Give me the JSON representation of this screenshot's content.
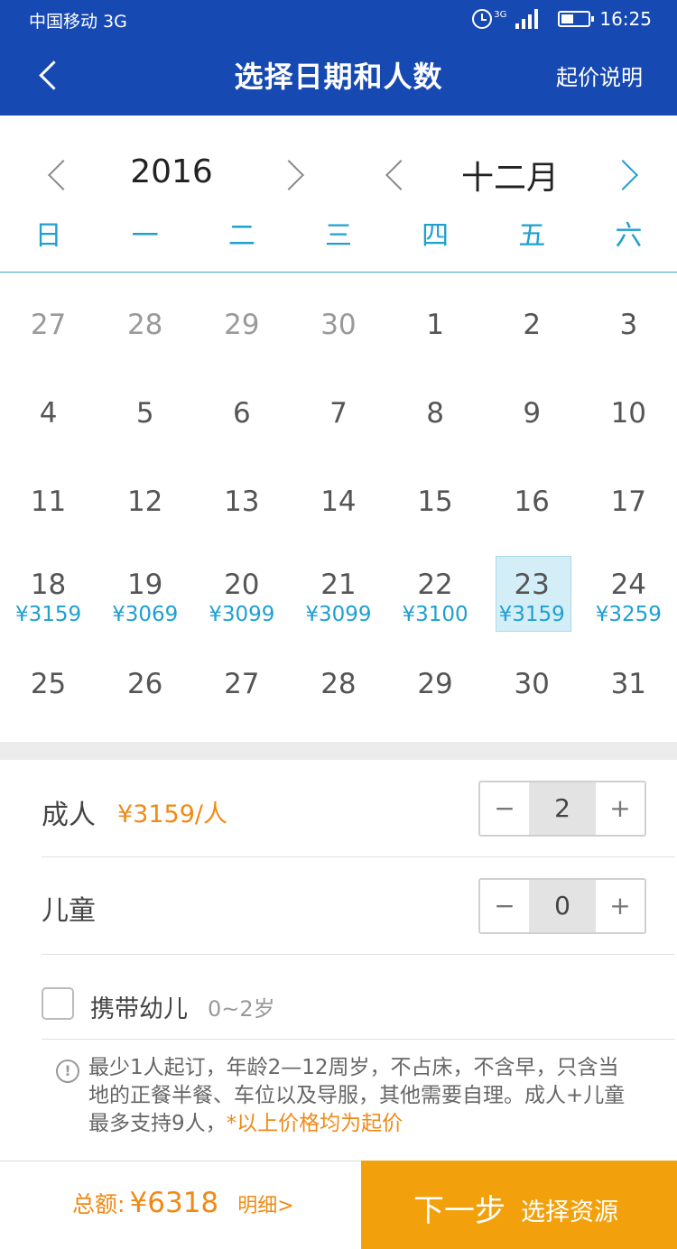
{
  "status_bar": {
    "carrier": "中国移动 3G",
    "network": "3G",
    "time": "16:25",
    "battery_level": 0.45
  },
  "header": {
    "title": "选择日期和人数",
    "right_link": "起价说明"
  },
  "calendar": {
    "year": "2016",
    "month": "十二月",
    "weekdays": [
      "日",
      "一",
      "二",
      "三",
      "四",
      "五",
      "六"
    ],
    "weeks": [
      [
        {
          "day": "27",
          "other": true
        },
        {
          "day": "28",
          "other": true
        },
        {
          "day": "29",
          "other": true
        },
        {
          "day": "30",
          "other": true
        },
        {
          "day": "1"
        },
        {
          "day": "2"
        },
        {
          "day": "3"
        }
      ],
      [
        {
          "day": "4"
        },
        {
          "day": "5"
        },
        {
          "day": "6"
        },
        {
          "day": "7"
        },
        {
          "day": "8"
        },
        {
          "day": "9"
        },
        {
          "day": "10"
        }
      ],
      [
        {
          "day": "11"
        },
        {
          "day": "12"
        },
        {
          "day": "13"
        },
        {
          "day": "14"
        },
        {
          "day": "15"
        },
        {
          "day": "16"
        },
        {
          "day": "17"
        }
      ],
      [
        {
          "day": "18",
          "price": "¥3159"
        },
        {
          "day": "19",
          "price": "¥3069"
        },
        {
          "day": "20",
          "price": "¥3099"
        },
        {
          "day": "21",
          "price": "¥3099"
        },
        {
          "day": "22",
          "price": "¥3100"
        },
        {
          "day": "23",
          "price": "¥3159",
          "selected": true
        },
        {
          "day": "24",
          "price": "¥3259"
        }
      ],
      [
        {
          "day": "25"
        },
        {
          "day": "26"
        },
        {
          "day": "27"
        },
        {
          "day": "28"
        },
        {
          "day": "29"
        },
        {
          "day": "30"
        },
        {
          "day": "31"
        }
      ]
    ]
  },
  "passengers": {
    "adult": {
      "label": "成人",
      "price": "¥3159/人",
      "minus": "−",
      "value": "2",
      "plus": "+"
    },
    "child": {
      "label": "儿童",
      "minus": "−",
      "value": "0",
      "plus": "+"
    },
    "infant": {
      "label": "携带幼儿",
      "age": "0~2岁",
      "checked": false
    }
  },
  "notice": {
    "text": "最少1人起订，年龄2—12周岁，不占床，不含早，只含当地的正餐半餐、车位以及导服，其他需要自理。成人+儿童最多支持9人，",
    "highlight": "*以上价格均为起价"
  },
  "footer": {
    "total_label": "总额:",
    "total_value": "¥6318",
    "detail_link": "明细>",
    "next_main": "下一步",
    "next_sub": "选择资源"
  },
  "colors": {
    "header_bg": "#1749b3",
    "accent_blue": "#1ea0d0",
    "orange": "#f08a16",
    "button_orange": "#f2a10c",
    "selected_bg": "#d4eef7"
  }
}
